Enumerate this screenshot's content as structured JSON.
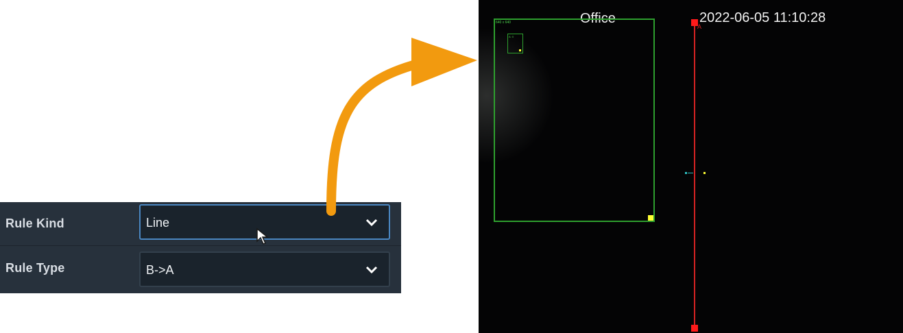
{
  "settings": {
    "rule_kind_label": "Rule Kind",
    "rule_kind_value": "Line",
    "rule_type_label": "Rule Type",
    "rule_type_value": "B->A"
  },
  "camera": {
    "channel_title": "Office",
    "timestamp": "2022-06-05 11:10:28",
    "zone_label": "640 x 640",
    "target_label": "A: 0",
    "line_mark": "A"
  },
  "colors": {
    "arrow": "#f29a0f",
    "zone": "#2ea02e",
    "line": "#d42222",
    "handle": "#ffff33"
  }
}
